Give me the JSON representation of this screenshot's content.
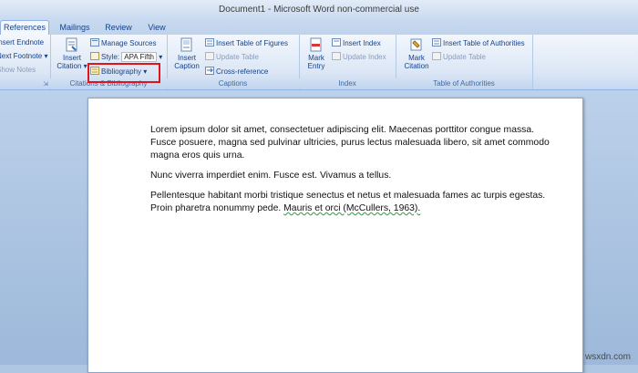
{
  "window": {
    "title": "Document1 - Microsoft Word non-commercial use"
  },
  "tabs": [
    "References",
    "Mailings",
    "Review",
    "View"
  ],
  "ribbon": {
    "footnotes": {
      "items": [
        "Insert Endnote",
        "Next Footnote",
        "Show Notes"
      ]
    },
    "citations": {
      "insert_citation_line1": "Insert",
      "insert_citation_line2": "Citation",
      "manage_sources": "Manage Sources",
      "style_label": "Style:",
      "style_value": "APA Fifth",
      "bibliography": "Bibliography",
      "group_label": "Citations & Bibliography"
    },
    "captions": {
      "insert_caption_line1": "Insert",
      "insert_caption_line2": "Caption",
      "insert_table_of_figures": "Insert Table of Figures",
      "update_table": "Update Table",
      "cross_reference": "Cross-reference",
      "group_label": "Captions"
    },
    "index": {
      "mark_entry_line1": "Mark",
      "mark_entry_line2": "Entry",
      "insert_index": "Insert Index",
      "update_index": "Update Index",
      "group_label": "Index"
    },
    "toa": {
      "mark_citation_line1": "Mark",
      "mark_citation_line2": "Citation",
      "insert_toa": "Insert Table of Authorities",
      "update_table": "Update Table",
      "group_label": "Table of Authorities"
    }
  },
  "document": {
    "para1": "Lorem ipsum dolor sit amet, consectetuer adipiscing elit. Maecenas porttitor congue massa. Fusce posuere, magna sed pulvinar ultricies, purus lectus malesuada libero, sit amet commodo magna eros quis urna.",
    "para2": "Nunc viverra imperdiet enim. Fusce est. Vivamus a tellus.",
    "para3_text": "Pellentesque habitant morbi tristique senectus et netus et malesuada fames ac turpis egestas. Proin pharetra nonummy pede. ",
    "para3_citation": "Mauris et orci (McCullers, 1963)."
  },
  "watermark": "wsxdn.com",
  "colors": {
    "highlight_box": "#e0141c",
    "ribbon_text": "#15428b",
    "spell_underline": "#3aa64a"
  }
}
